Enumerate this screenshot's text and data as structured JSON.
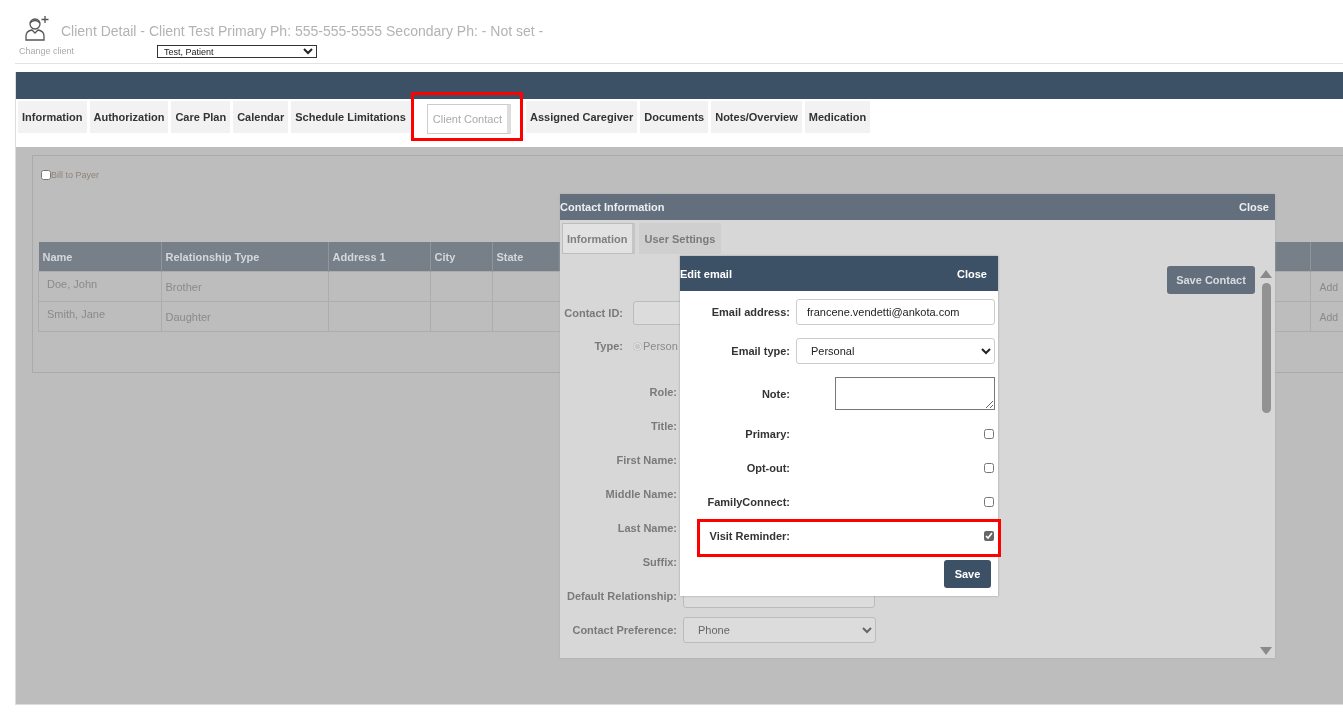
{
  "header": {
    "title": "Client Detail - Client Test Primary Ph: 555-555-5555 Secondary Ph: - Not set -",
    "change_client_label": "Change client",
    "client_select": "Test, Patient"
  },
  "tabs": [
    {
      "label": "Information",
      "selected": false,
      "highlighted": false
    },
    {
      "label": "Authorization",
      "selected": false,
      "highlighted": false
    },
    {
      "label": "Care Plan",
      "selected": false,
      "highlighted": false
    },
    {
      "label": "Calendar",
      "selected": false,
      "highlighted": false
    },
    {
      "label": "Schedule Limitations",
      "selected": false,
      "highlighted": false
    },
    {
      "label": "Client Contact",
      "selected": true,
      "highlighted": true
    },
    {
      "label": "Assigned Caregiver",
      "selected": false,
      "highlighted": false
    },
    {
      "label": "Documents",
      "selected": false,
      "highlighted": false
    },
    {
      "label": "Notes/Overview",
      "selected": false,
      "highlighted": false
    },
    {
      "label": "Medication",
      "selected": false,
      "highlighted": false
    }
  ],
  "bill_to_payer": {
    "label": "Bill to Payer",
    "checked": false
  },
  "table": {
    "columns": [
      "Name",
      "Relationship Type",
      "Address 1",
      "City",
      "State"
    ],
    "rows": [
      {
        "name": "Doe, John",
        "relationship_type": "Brother",
        "column_last": "Add"
      },
      {
        "name": "Smith, Jane",
        "relationship_type": "Daughter",
        "column_last": "Add"
      }
    ]
  },
  "contact_modal": {
    "title": "Contact Information",
    "close": "Close",
    "tabs": [
      {
        "label": "Information",
        "selected": true
      },
      {
        "label": "User Settings",
        "selected": false
      }
    ],
    "save_button": "Save Contact",
    "fields": [
      {
        "kind": "compact-input",
        "label": "Contact ID:"
      },
      {
        "kind": "compact-radio",
        "label": "Type:",
        "option": "Person",
        "checked": true
      },
      {
        "kind": "plain",
        "label": "Role:"
      },
      {
        "kind": "plain",
        "label": "Title:"
      },
      {
        "kind": "plain",
        "label": "First Name:"
      },
      {
        "kind": "plain",
        "label": "Middle Name:"
      },
      {
        "kind": "plain",
        "label": "Last Name:"
      },
      {
        "kind": "plain",
        "label": "Suffix:"
      },
      {
        "kind": "input",
        "label": "Default Relationship:"
      },
      {
        "kind": "select",
        "label": "Contact Preference:",
        "value": "Phone"
      }
    ]
  },
  "edit_modal": {
    "title": "Edit email",
    "close": "Close",
    "fields": [
      {
        "kind": "text",
        "label": "Email address:",
        "value": "francene.vendetti@ankota.com"
      },
      {
        "kind": "select",
        "label": "Email type:",
        "value": "Personal"
      },
      {
        "kind": "textarea",
        "label": "Note:"
      },
      {
        "kind": "checkbox",
        "label": "Primary:",
        "checked": false,
        "highlighted": false
      },
      {
        "kind": "checkbox",
        "label": "Opt-out:",
        "checked": false,
        "highlighted": false
      },
      {
        "kind": "checkbox",
        "label": "FamilyConnect:",
        "checked": false,
        "highlighted": false
      },
      {
        "kind": "checkbox",
        "label": "Visit Reminder:",
        "checked": true,
        "highlighted": true
      }
    ],
    "save_button": "Save"
  }
}
